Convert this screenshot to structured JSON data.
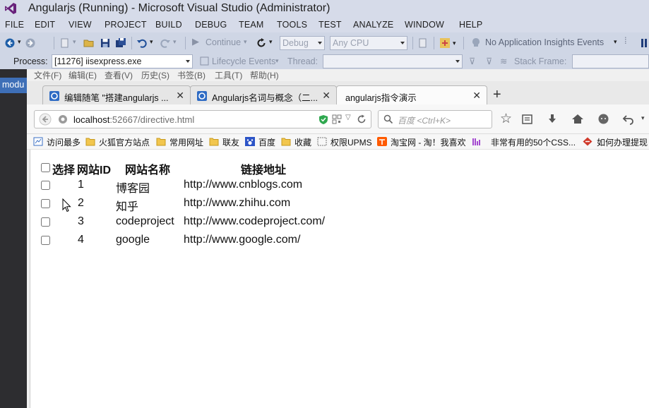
{
  "vs": {
    "title": "Angularjs (Running) - Microsoft Visual Studio (Administrator)",
    "menu": [
      "FILE",
      "EDIT",
      "VIEW",
      "PROJECT",
      "BUILD",
      "DEBUG",
      "TEAM",
      "TOOLS",
      "TEST",
      "ANALYZE",
      "WINDOW",
      "HELP"
    ],
    "toolbar": {
      "continue_label": "Continue",
      "config_value": "Debug",
      "platform_value": "Any CPU",
      "insights_label": "No Application Insights Events"
    },
    "toolbar2": {
      "process_label": "Process:",
      "process_value": "[11276] iisexpress.exe",
      "lifecycle_label": "Lifecycle Events",
      "thread_label": "Thread:",
      "stack_label": "Stack Frame:"
    },
    "left_tab": "modu"
  },
  "firefox": {
    "menu": [
      "文件(F)",
      "编辑(E)",
      "查看(V)",
      "历史(S)",
      "书签(B)",
      "工具(T)",
      "帮助(H)"
    ],
    "tabs": [
      {
        "title": "编辑随笔 \"搭建angularjs ...",
        "active": false
      },
      {
        "title": "Angularjs名词与概念（二...",
        "active": false
      },
      {
        "title": "angularjs指令演示",
        "active": true
      }
    ],
    "url": {
      "host": "localhost",
      "rest": ":52667/directive.html"
    },
    "search_placeholder": "百度 <Ctrl+K>",
    "bookmarks": [
      "访问最多",
      "火狐官方站点",
      "常用网址",
      "联友",
      "百度",
      "收藏",
      "权限UPMS",
      "淘宝网 - 淘！我喜欢",
      "非常有用的50个CSS...",
      "如何办理提现"
    ]
  },
  "table": {
    "headers": {
      "select": "选择",
      "id": "网站ID",
      "name": "网站名称",
      "url": "链接地址"
    },
    "rows": [
      {
        "id": "1",
        "name": "博客园",
        "url": "http://www.cnblogs.com"
      },
      {
        "id": "2",
        "name": "知乎",
        "url": "http://www.zhihu.com"
      },
      {
        "id": "3",
        "name": "codeproject",
        "url": "http://www.codeproject.com/"
      },
      {
        "id": "4",
        "name": "google",
        "url": "http://www.google.com/"
      }
    ]
  }
}
